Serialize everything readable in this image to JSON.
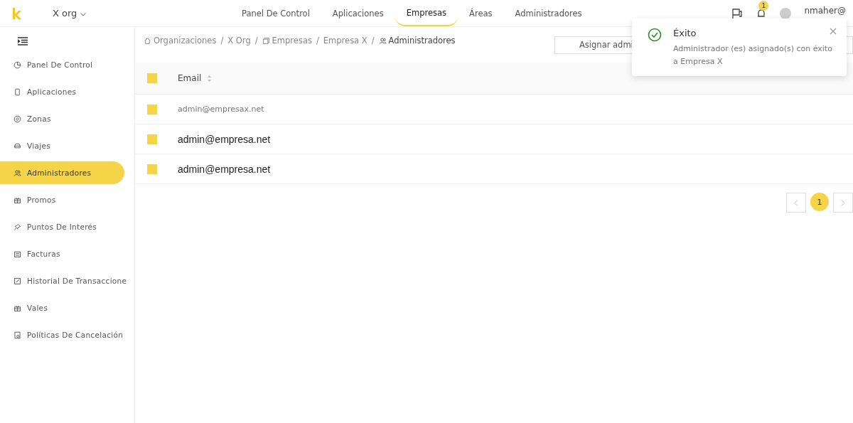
{
  "header": {
    "org": "X org",
    "nav": [
      {
        "label": "Panel De Control",
        "selected": false
      },
      {
        "label": "Aplicaciones",
        "selected": false
      },
      {
        "label": "Empresas",
        "selected": true
      },
      {
        "label": "Áreas",
        "selected": false
      },
      {
        "label": "Administradores",
        "selected": false
      }
    ],
    "notification_count": "1",
    "user": "nmaher@"
  },
  "sidebar": {
    "items": [
      {
        "label": "Panel De Control",
        "selected": false
      },
      {
        "label": "Aplicaciones",
        "selected": false
      },
      {
        "label": "Zonas",
        "selected": false
      },
      {
        "label": "Viajes",
        "selected": false
      },
      {
        "label": "Administradores",
        "selected": true
      },
      {
        "label": "Promos",
        "selected": false
      },
      {
        "label": "Puntos De Interés",
        "selected": false
      },
      {
        "label": "Facturas",
        "selected": false
      },
      {
        "label": "Historial De Transaccione",
        "selected": false
      },
      {
        "label": "Vales",
        "selected": false
      },
      {
        "label": "Políticas De Cancelación",
        "selected": false
      }
    ]
  },
  "breadcrumb": [
    {
      "label": "Organizaciones"
    },
    {
      "label": "X Org",
      "separator": "/"
    },
    {
      "label": "Empresas",
      "separator": "/"
    },
    {
      "label": "Empresa X",
      "separator": "/"
    },
    {
      "label": "Administradores",
      "separator": "/"
    }
  ],
  "assign_button": "Asignar admi",
  "table": {
    "header_checked": true,
    "columns": [
      "Email"
    ],
    "rows": [
      {
        "email": "admin@empresax.net",
        "kind": "muted",
        "checked": true
      },
      {
        "email": "admin@empresa.net",
        "kind": "plain",
        "checked": true
      },
      {
        "email": "admin@empresa.net",
        "kind": "plain",
        "checked": true
      }
    ]
  },
  "pagination": {
    "pages": [
      {
        "label": "1",
        "selected": true
      }
    ]
  },
  "toast": {
    "title": "Éxito",
    "message": "Administrador (es) asignado(s) con éxito a Empresa X"
  }
}
